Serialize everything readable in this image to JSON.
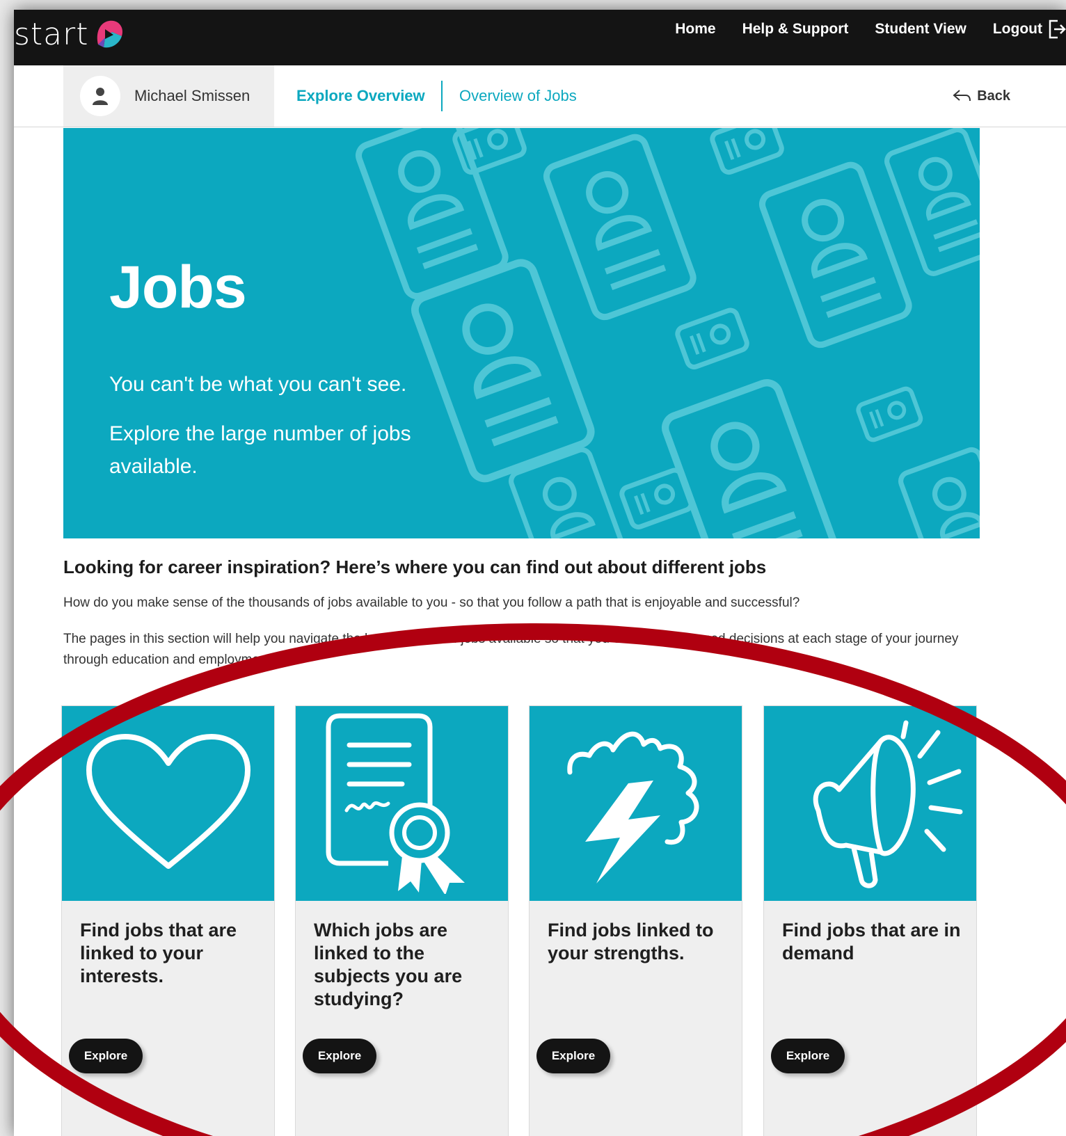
{
  "app": {
    "logo_text": "start",
    "nav": {
      "home": "Home",
      "help": "Help & Support",
      "student_view": "Student View",
      "logout": "Logout"
    }
  },
  "subheader": {
    "user_name": "Michael Smissen",
    "tab_active": "Explore Overview",
    "tab_other": "Overview of Jobs",
    "back": "Back"
  },
  "hero": {
    "title": "Jobs",
    "line1": "You can't be what you can't see.",
    "line2": "Explore the large number of jobs available."
  },
  "intro": {
    "heading": "Looking for career inspiration? Here’s where you can find out about different jobs",
    "p1": "How do you make sense of the thousands of jobs available to you - so that you follow a path that is enjoyable and successful?",
    "p2": "The pages in this section will help you navigate the huge number of jobs available so that you can make informed decisions at each stage of your journey through education and employment."
  },
  "cards": [
    {
      "title": "Find jobs that are linked to your interests.",
      "button": "Explore",
      "icon": "heart-icon"
    },
    {
      "title": "Which jobs are linked to the subjects you are studying?",
      "button": "Explore",
      "icon": "certificate-icon"
    },
    {
      "title": "Find jobs linked to your strengths.",
      "button": "Explore",
      "icon": "lightning-burst-icon"
    },
    {
      "title": "Find jobs that are in demand",
      "button": "Explore",
      "icon": "megaphone-icon"
    }
  ],
  "colors": {
    "brand_teal": "#0ca8bf",
    "topbar": "#141414",
    "annotation_red": "#b00010"
  }
}
